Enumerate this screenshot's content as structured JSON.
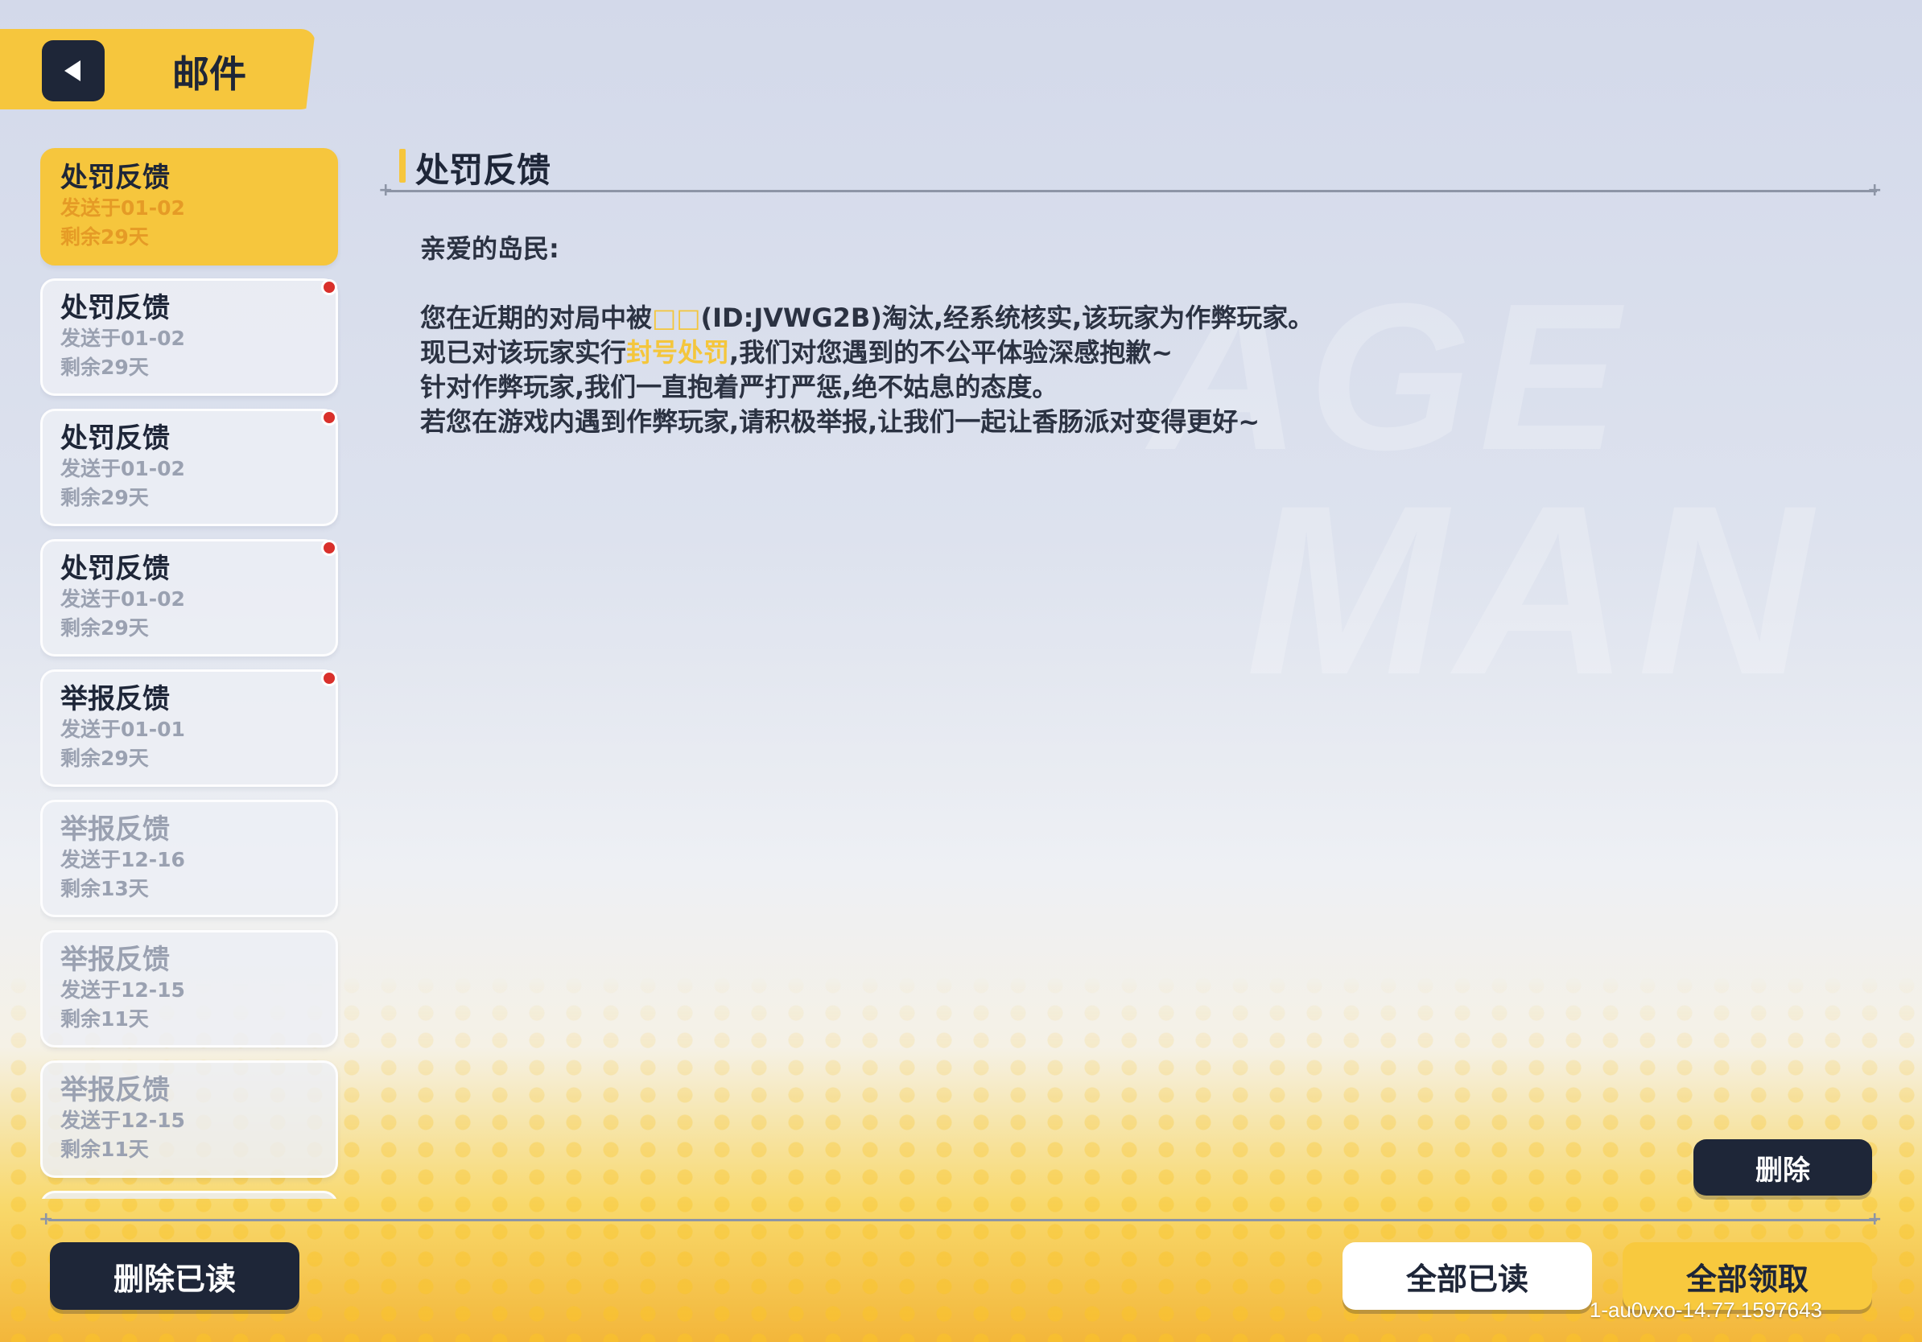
{
  "header": {
    "title": "邮件"
  },
  "mail_list": [
    {
      "title": "处罚反馈",
      "sent": "发送于01-02",
      "remaining": "剩余29天",
      "selected": true,
      "unread": false,
      "read": false
    },
    {
      "title": "处罚反馈",
      "sent": "发送于01-02",
      "remaining": "剩余29天",
      "selected": false,
      "unread": true,
      "read": false
    },
    {
      "title": "处罚反馈",
      "sent": "发送于01-02",
      "remaining": "剩余29天",
      "selected": false,
      "unread": true,
      "read": false
    },
    {
      "title": "处罚反馈",
      "sent": "发送于01-02",
      "remaining": "剩余29天",
      "selected": false,
      "unread": true,
      "read": false
    },
    {
      "title": "举报反馈",
      "sent": "发送于01-01",
      "remaining": "剩余29天",
      "selected": false,
      "unread": true,
      "read": false
    },
    {
      "title": "举报反馈",
      "sent": "发送于12-16",
      "remaining": "剩余13天",
      "selected": false,
      "unread": false,
      "read": true
    },
    {
      "title": "举报反馈",
      "sent": "发送于12-15",
      "remaining": "剩余11天",
      "selected": false,
      "unread": false,
      "read": true
    },
    {
      "title": "举报反馈",
      "sent": "发送于12-15",
      "remaining": "剩余11天",
      "selected": false,
      "unread": false,
      "read": true
    }
  ],
  "detail": {
    "title": "处罚反馈",
    "greeting": "亲爱的岛民:",
    "line1_a": "您在近期的对局中被",
    "line1_name": "□□",
    "line1_b": "(ID:JVWG2B)淘汰,经系统核实,该玩家为作弊玩家。",
    "line2_a": "现已对该玩家实行",
    "line2_hl": "封号处罚",
    "line2_b": ",我们对您遇到的不公平体验深感抱歉~",
    "line3": "针对作弊玩家,我们一直抱着严打严惩,绝不姑息的态度。",
    "line4": "若您在游戏内遇到作弊玩家,请积极举报,让我们一起让香肠派对变得更好~"
  },
  "buttons": {
    "delete": "删除",
    "delete_read": "删除已读",
    "read_all": "全部已读",
    "claim_all": "全部领取"
  },
  "version": "1-au0vxo-14.77.1597643",
  "colors": {
    "accent_yellow": "#f6c63d",
    "dark_navy": "#1e2638",
    "unread_dot": "#d9302b"
  },
  "icons": {
    "back": "back-arrow-icon"
  }
}
